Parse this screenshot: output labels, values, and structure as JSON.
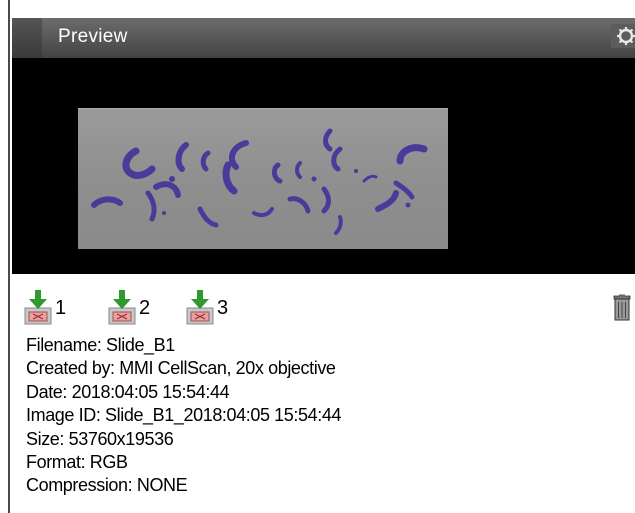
{
  "panel": {
    "title": "Preview"
  },
  "exports": [
    {
      "label": "1",
      "icon": "export-down-arrow-icon"
    },
    {
      "label": "2",
      "icon": "export-down-arrow-icon"
    },
    {
      "label": "3",
      "icon": "export-down-arrow-icon"
    }
  ],
  "info": {
    "filename": "Filename: Slide_B1",
    "created_by": "Created by: MMI CellScan, 20x objective",
    "date": "Date: 2018:04:05 15:54:44",
    "image_id": "Image ID: Slide_B1_2018:04:05 15:54:44",
    "size": "Size: 53760x19536",
    "format": "Format: RGB",
    "compression": "Compression: NONE"
  },
  "colors": {
    "titlebar": "#5a5a5a",
    "preview_bg": "#000000",
    "slide": "#8f8f8f",
    "tissue": "#4b3a9a",
    "arrow_green": "#2e9a2e"
  }
}
